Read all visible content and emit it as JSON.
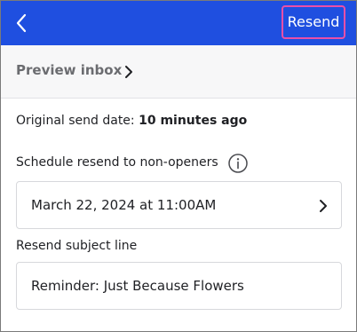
{
  "header": {
    "back_icon": "chevron-left-icon",
    "resend_label": "Resend"
  },
  "preview": {
    "label": "Preview inbox",
    "chevron_icon": "chevron-right-icon"
  },
  "send_info": {
    "label": "Original send date:",
    "value": "10 minutes ago"
  },
  "schedule": {
    "label": "Schedule resend to non-openers",
    "info_icon": "info-icon",
    "date_value": "March 22, 2024 at 11:00AM",
    "chevron_icon": "chevron-right-icon"
  },
  "subject": {
    "label": "Resend subject line",
    "value": "Reminder: Just Because Flowers"
  },
  "colors": {
    "header_bg": "#1f4fe0",
    "highlight": "#ea4fa8"
  }
}
